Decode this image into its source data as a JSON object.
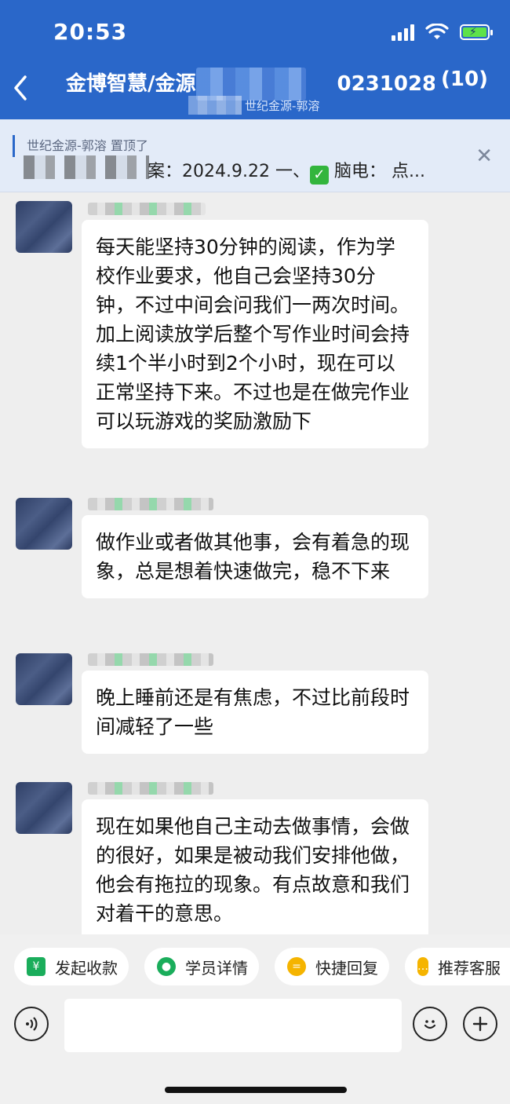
{
  "status": {
    "time": "20:53"
  },
  "nav": {
    "title": "金博智慧/金源-世纪金源-郭溶0231028/...",
    "title_visible": "金博智慧/金源",
    "title_tail": "0231028/...",
    "count": "(10)",
    "subtitle": "世纪金源-郭溶"
  },
  "pinned": {
    "label": "世纪金源-郭溶 置顶了",
    "text_prefix": "案：2024.9.22 一、",
    "text_suffix": "脑电： 点..."
  },
  "messages": [
    {
      "text": "每天能坚持30分钟的阅读，作为学校作业要求，他自己会坚持30分钟，不过中间会问我们一两次时间。加上阅读放学后整个写作业时间会持续1个半小时到2个小时，现在可以正常坚持下来。不过也是在做完作业可以玩游戏的奖励激励下"
    },
    {
      "text": "做作业或者做其他事，会有着急的现象，总是想着快速做完，稳不下来"
    },
    {
      "text": "晚上睡前还是有焦虑，不过比前段时间减轻了一些"
    },
    {
      "text": "现在如果他自己主动去做事情，会做的很好，如果是被动我们安排他做，他会有拖拉的现象。有点故意和我们对着干的意思。"
    }
  ],
  "quick_actions": [
    {
      "label": "发起收款",
      "icon": "yen-icon",
      "color": "#1aad5b"
    },
    {
      "label": "学员详情",
      "icon": "user-icon",
      "color": "#1aad5b"
    },
    {
      "label": "快捷回复",
      "icon": "chat-icon",
      "color": "#f5b400"
    },
    {
      "label": "推荐客服",
      "icon": "service-icon",
      "color": "#f5b400"
    }
  ],
  "colors": {
    "header": "#2a67c9",
    "background": "#eeeeee",
    "bubble": "#ffffff"
  }
}
